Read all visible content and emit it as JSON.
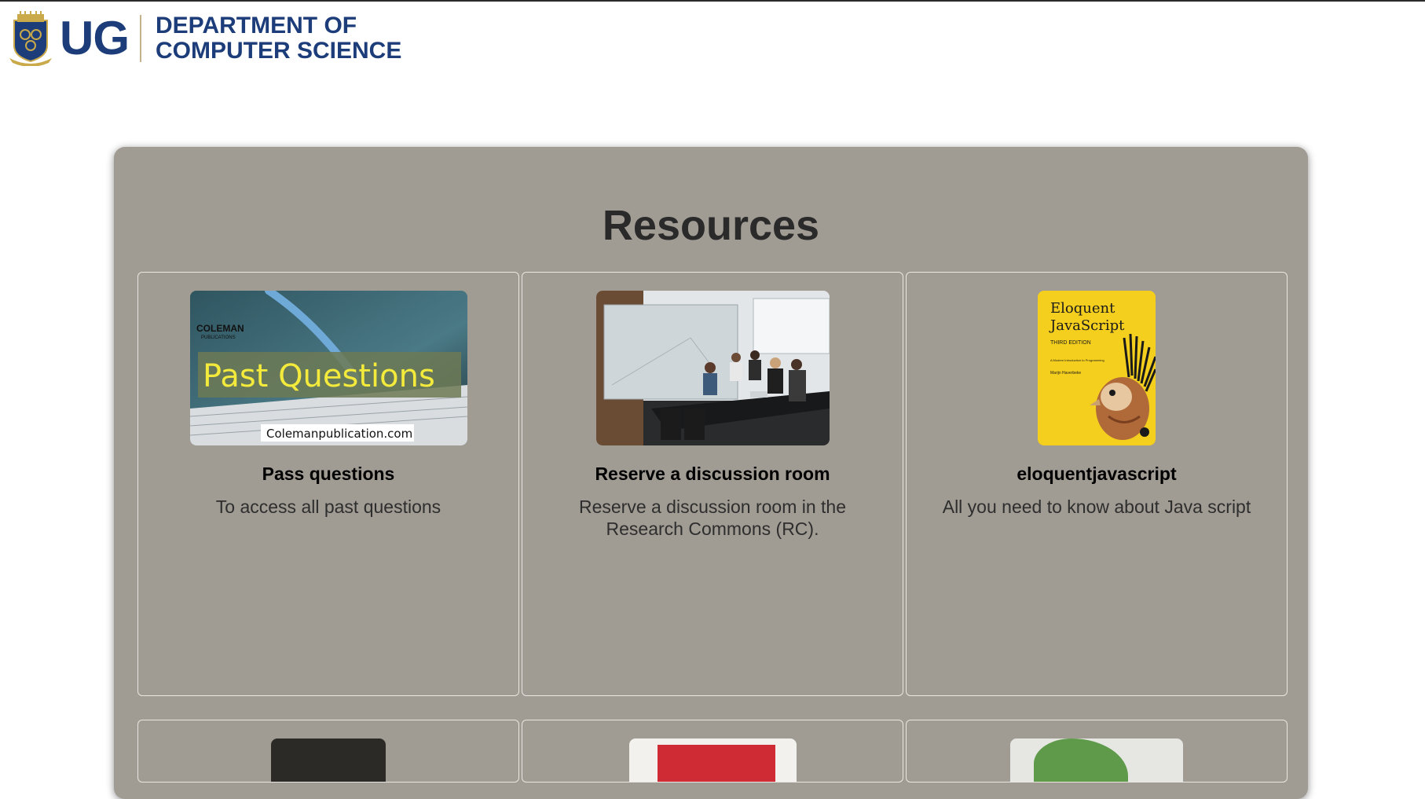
{
  "header": {
    "logo_text": "UG",
    "department_line1": "DEPARTMENT OF",
    "department_line2": "COMPUTER SCIENCE"
  },
  "main": {
    "title": "Resources",
    "cards": [
      {
        "title": "Pass questions",
        "description": "To access all past questions",
        "image": {
          "banner_text": "Past Questions",
          "publisher": "COLEMAN",
          "publisher_sub": "PUBLICATIONS",
          "url_text": "Colemanpublication.com"
        }
      },
      {
        "title": "Reserve a discussion room",
        "description": "Reserve a discussion room in the Research Commons (RC).",
        "image": {
          "subject": "meeting-room-photo"
        }
      },
      {
        "title": "eloquentjavascript",
        "description": "All you need to know about Java script",
        "image": {
          "cover_title_1": "Eloquent",
          "cover_title_2": "JavaScript",
          "edition": "THIRD EDITION",
          "subtitle": "A Modern Introduction to Programming",
          "author": "Marijn Haverbeke"
        }
      }
    ]
  },
  "colors": {
    "brand_blue": "#1c3d7a",
    "panel_bg": "#a09b93",
    "book_yellow": "#f5cf1e"
  }
}
